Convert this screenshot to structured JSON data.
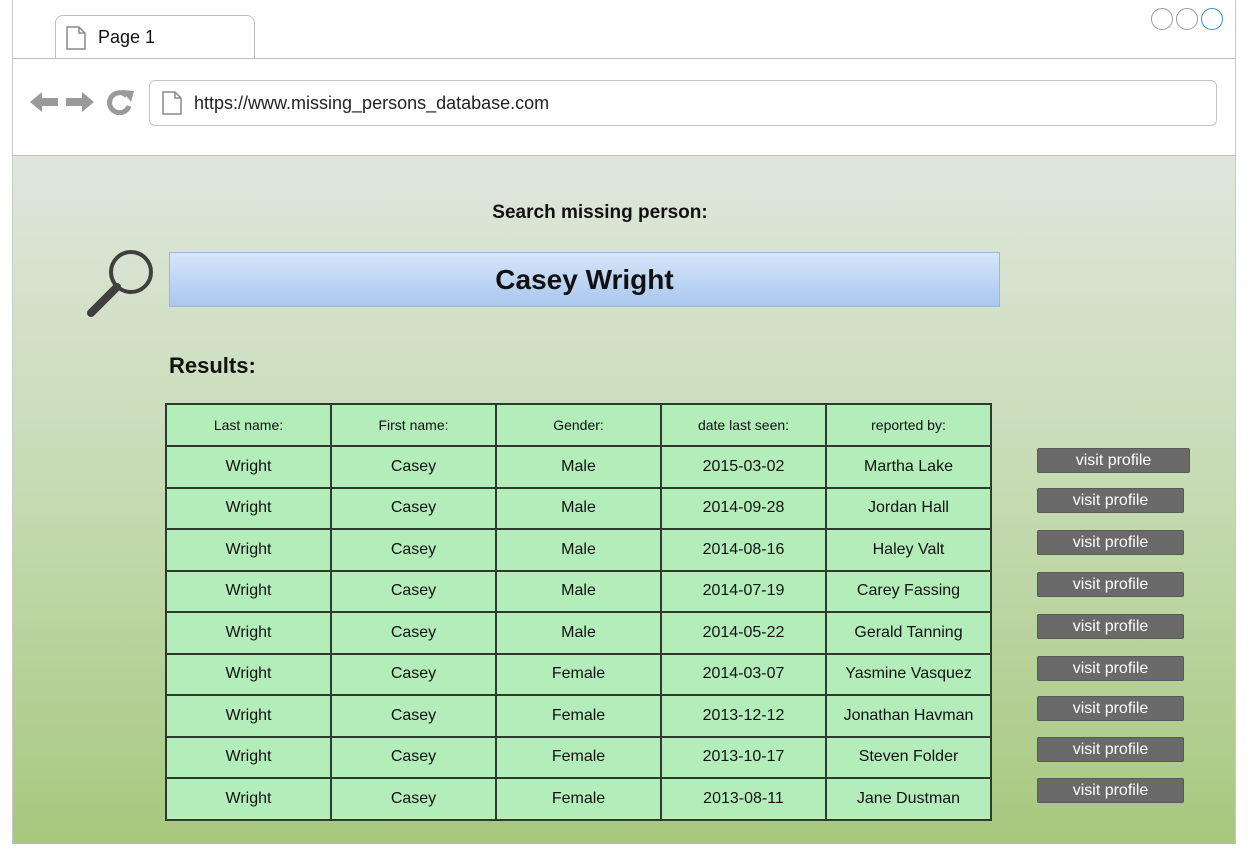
{
  "browser": {
    "tab_label": "Page 1",
    "url": "https://www.missing_persons_database.com"
  },
  "search": {
    "heading": "Search missing person:",
    "query": "Casey Wright"
  },
  "results": {
    "label": "Results:",
    "columns": [
      "Last name:",
      "First name:",
      "Gender:",
      "date last seen:",
      "reported by:"
    ],
    "rows": [
      [
        "Wright",
        "Casey",
        "Male",
        "2015-03-02",
        "Martha Lake"
      ],
      [
        "Wright",
        "Casey",
        "Male",
        "2014-09-28",
        "Jordan Hall"
      ],
      [
        "Wright",
        "Casey",
        "Male",
        "2014-08-16",
        "Haley Valt"
      ],
      [
        "Wright",
        "Casey",
        "Male",
        "2014-07-19",
        "Carey Fassing"
      ],
      [
        "Wright",
        "Casey",
        "Male",
        "2014-05-22",
        "Gerald Tanning"
      ],
      [
        "Wright",
        "Casey",
        "Female",
        "2014-03-07",
        "Yasmine Vasquez"
      ],
      [
        "Wright",
        "Casey",
        "Female",
        "2013-12-12",
        "Jonathan Havman"
      ],
      [
        "Wright",
        "Casey",
        "Female",
        "2013-10-17",
        "Steven Folder"
      ],
      [
        "Wright",
        "Casey",
        "Female",
        "2013-08-11",
        "Jane Dustman"
      ]
    ],
    "visit_label": "visit profile"
  }
}
